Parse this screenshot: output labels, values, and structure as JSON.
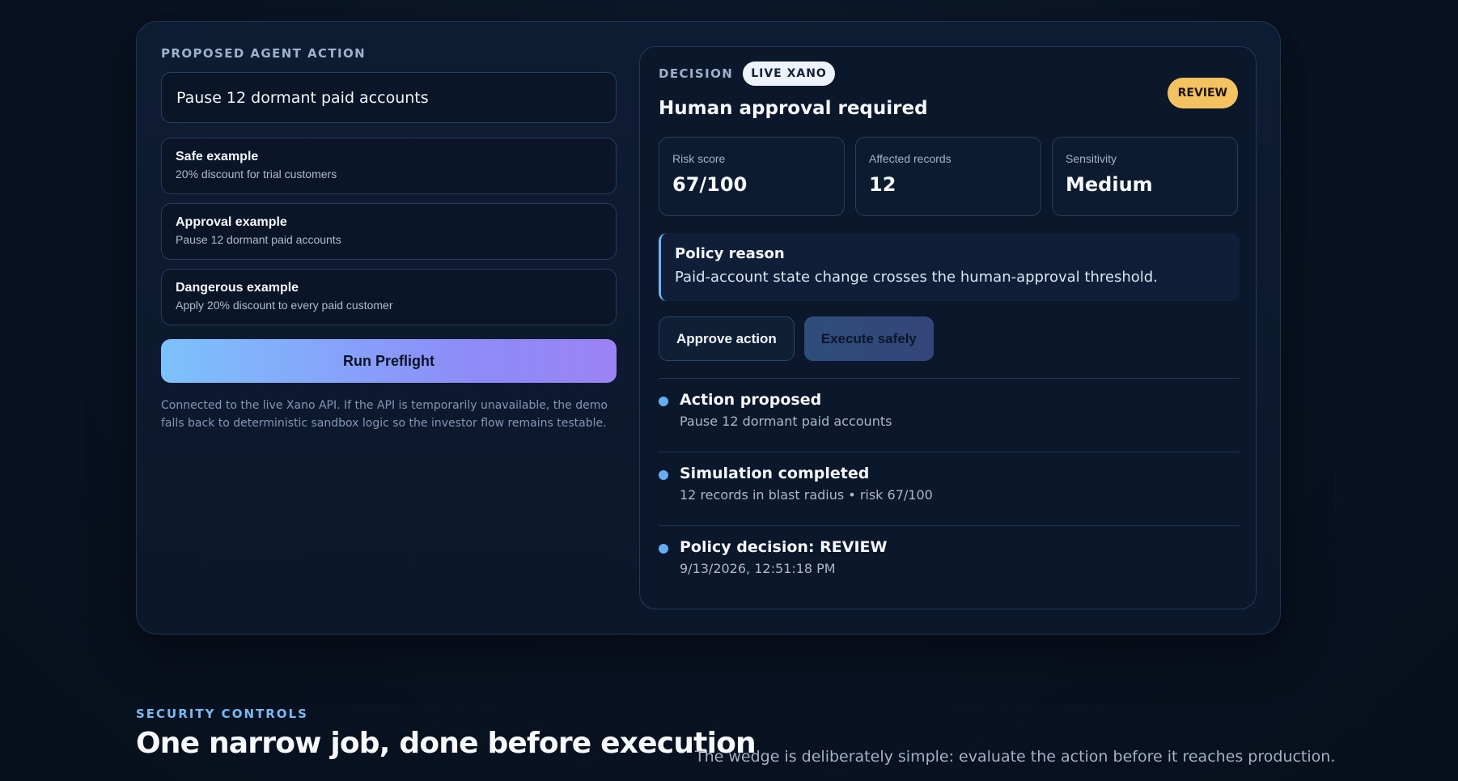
{
  "proposed": {
    "eyebrow": "PROPOSED AGENT ACTION",
    "input_value": "Pause 12 dormant paid accounts",
    "examples": [
      {
        "title": "Safe example",
        "desc": "20% discount for trial customers"
      },
      {
        "title": "Approval example",
        "desc": "Pause 12 dormant paid accounts"
      },
      {
        "title": "Dangerous example",
        "desc": "Apply 20% discount to every paid customer"
      }
    ],
    "run_label": "Run Preflight",
    "note": "Connected to the live Xano API. If the API is temporarily unavailable, the demo falls back to deterministic sandbox logic so the investor flow remains testable."
  },
  "decision": {
    "eyebrow": "DECISION",
    "pill": "LIVE XANO",
    "badge": "REVIEW",
    "headline": "Human approval required",
    "metrics": [
      {
        "label": "Risk score",
        "value": "67/100"
      },
      {
        "label": "Affected records",
        "value": "12"
      },
      {
        "label": "Sensitivity",
        "value": "Medium"
      }
    ],
    "reason_title": "Policy reason",
    "reason_text": "Paid-account state change crosses the human-approval threshold.",
    "approve_label": "Approve action",
    "execute_label": "Execute safely",
    "timeline": [
      {
        "title": "Action proposed",
        "detail": "Pause 12 dormant paid accounts"
      },
      {
        "title": "Simulation completed",
        "detail": "12 records in blast radius • risk 67/100"
      },
      {
        "title": "Policy decision: REVIEW",
        "detail": "9/13/2026, 12:51:18 PM"
      }
    ]
  },
  "security": {
    "eyebrow": "SECURITY CONTROLS",
    "title": "One narrow job, done before execution",
    "desc": "The wedge is deliberately simple: evaluate the action before it reaches production."
  },
  "colors": {
    "accent_blue": "#64aef2",
    "review": "#f4c35f",
    "background": "#0a1424"
  }
}
